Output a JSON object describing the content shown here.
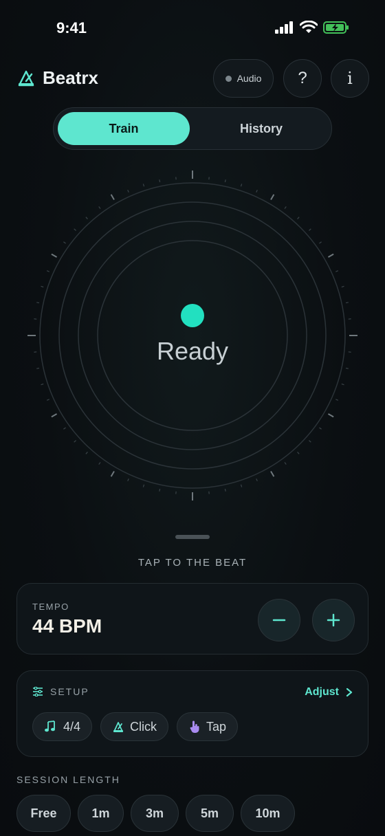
{
  "status_bar": {
    "time": "9:41"
  },
  "header": {
    "app_name": "Beatrx",
    "audio_label": "Audio",
    "help_label": "?",
    "info_label": "i"
  },
  "tabs": {
    "train": "Train",
    "history": "History",
    "active": "Train"
  },
  "dial": {
    "status_text": "Ready"
  },
  "instruction": "TAP TO THE BEAT",
  "tempo": {
    "label": "TEMPO",
    "value": "44 BPM"
  },
  "setup": {
    "label": "SETUP",
    "adjust_label": "Adjust",
    "chips": [
      {
        "icon": "notes-icon",
        "label": "4/4"
      },
      {
        "icon": "metronome-icon",
        "label": "Click"
      },
      {
        "icon": "hand-icon",
        "label": "Tap"
      }
    ]
  },
  "session": {
    "label": "SESSION LENGTH",
    "options": [
      "Free",
      "1m",
      "3m",
      "5m",
      "10m"
    ]
  },
  "colors": {
    "accent": "#5ee6cf",
    "background": "#0b0f12",
    "card": "#0f1519",
    "tap_icon": "#a98bf0"
  }
}
